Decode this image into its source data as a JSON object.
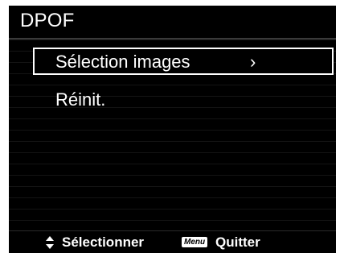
{
  "header": {
    "title": "DPOF"
  },
  "menu": {
    "items": [
      {
        "label": "Sélection images",
        "chevron": "›",
        "selected": true
      },
      {
        "label": "Réinit.",
        "selected": false
      }
    ]
  },
  "footer": {
    "navigate_icon": "up-down-arrows-icon",
    "navigate_label": "Sélectionner",
    "menu_key_label": "Menu",
    "quit_label": "Quitter"
  },
  "colors": {
    "background": "#000000",
    "text": "#ffffff",
    "selection_border": "#ffffff",
    "screen_border": "#ffffff"
  }
}
